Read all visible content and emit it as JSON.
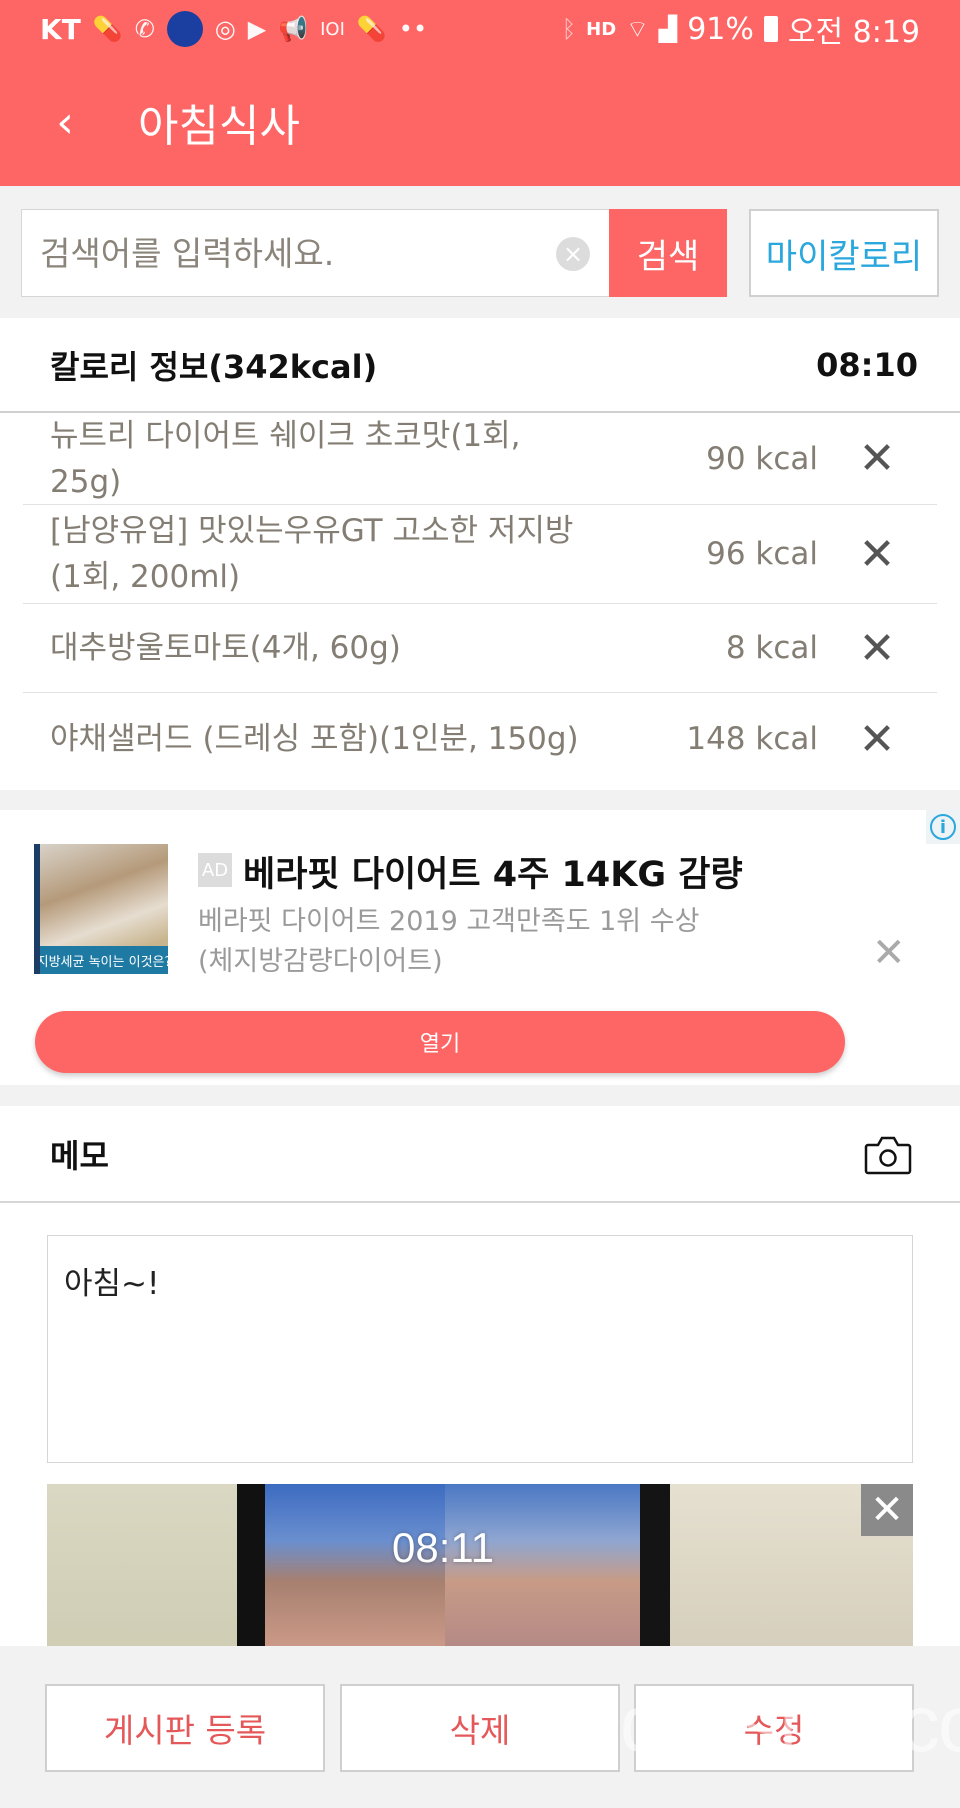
{
  "status_bar": {
    "carrier": "KT",
    "left_icons": [
      "pill-icon",
      "phone-whowho-icon",
      "jooni-app-icon",
      "dashin-app-icon",
      "youtube-icon",
      "megaphone-icon",
      "ioi-icon",
      "pill-icon",
      "more-dots-icon"
    ],
    "right_icons": [
      "bluetooth-icon",
      "hd-voice-icon",
      "wifi-icon",
      "signal-icon"
    ],
    "battery": "91%",
    "time": "오전 8:19"
  },
  "app_bar": {
    "back_label": "‹",
    "title": "아침식사"
  },
  "search": {
    "placeholder": "검색어를 입력하세요.",
    "value": "",
    "clear_label": "×",
    "search_button": "검색",
    "my_calorie_button": "마이칼로리"
  },
  "calorie_info": {
    "title": "칼로리 정보(342kcal)",
    "time": "08:10",
    "items": [
      {
        "name": "뉴트리 다이어트 쉐이크 초코맛(1회, 25g)",
        "kcal": "90 kcal"
      },
      {
        "name": "[남양유업] 맛있는우유GT 고소한 저지방(1회, 200ml)",
        "kcal": "96 kcal"
      },
      {
        "name": "대추방울토마토(4개, 60g)",
        "kcal": "8 kcal"
      },
      {
        "name": "야채샐러드 (드레싱 포함)(1인분, 150g)",
        "kcal": "148 kcal"
      }
    ],
    "delete_label": "✕"
  },
  "ad": {
    "info_label": "i",
    "badge": "AD",
    "image_caption": "지방세균 녹이는 이것은?",
    "headline": "베라핏 다이어트 4주 14KG 감량",
    "description": "베라핏 다이어트 2019 고객만족도 1위 수상(체지방감량다이어트)",
    "close_label": "✕",
    "open_button": "열기"
  },
  "memo": {
    "title": "메모",
    "text": "아침~!",
    "photo_clock": "08:11",
    "photo_close_label": "✕"
  },
  "actions": {
    "register": "게시판 등록",
    "delete": "삭제",
    "edit": "수정"
  },
  "watermark": "dietshin.com",
  "colors": {
    "primary": "#fe6565",
    "accent_blue": "#2aa7dd",
    "button_text": "#e4585a"
  }
}
